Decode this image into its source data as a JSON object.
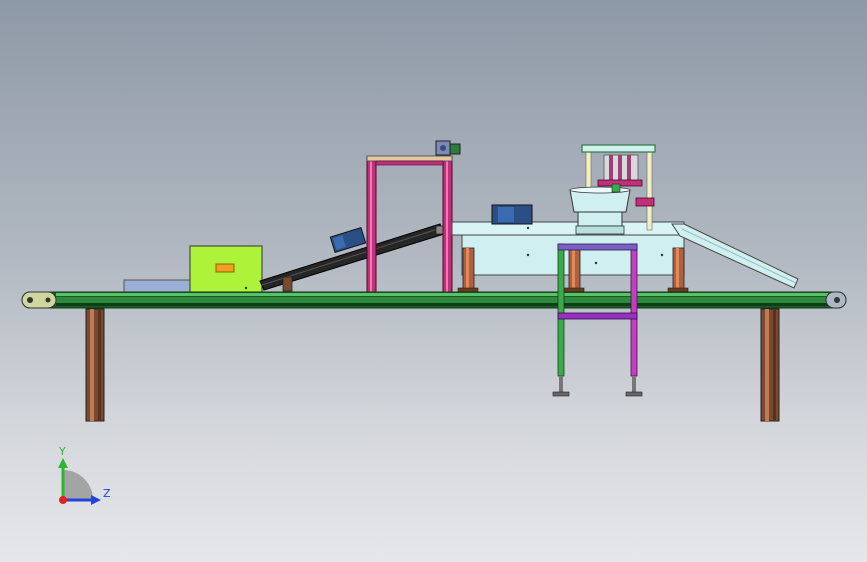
{
  "viewport": {
    "background_top": "#8e99a7",
    "background_bottom": "#e6e7ea"
  },
  "triad": {
    "y_label": "Y",
    "z_label": "Z",
    "y_color": "#2fb52f",
    "z_color": "#2244dd",
    "x_color": "#dd2222"
  },
  "colors": {
    "belt_green": "#2e8b3e",
    "belt_dark": "#0f3d17",
    "leg_brown": "#9c5a3a",
    "frame_magenta": "#c0307a",
    "green_box": "#aef23a",
    "table_top": "#cfeff0",
    "incline_belt": "#262626",
    "motor_blue": "#2a4f86"
  }
}
